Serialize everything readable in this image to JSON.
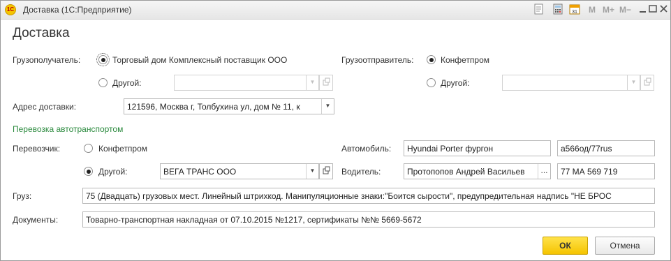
{
  "window": {
    "title": "Доставка  (1С:Предприятие)",
    "toolbar_icons": [
      "note-icon",
      "calculator-icon",
      "calendar-icon"
    ],
    "memory_buttons": [
      "M",
      "M+",
      "M−"
    ],
    "controls": [
      "minimize-icon",
      "maximize-icon",
      "close-icon"
    ]
  },
  "form": {
    "heading": "Доставка",
    "consignee": {
      "label": "Грузополучатель:",
      "option1": "Торговый дом Комплексный поставщик ООО",
      "option2": "Другой:",
      "other_value": ""
    },
    "shipper": {
      "label": "Грузоотправитель:",
      "option1": "Конфетпром",
      "option2": "Другой:",
      "other_value": ""
    },
    "address": {
      "label": "Адрес доставки:",
      "value": "121596, Москва г, Толбухина ул, дом № 11, к"
    },
    "transport_section": "Перевозка автотранспортом",
    "carrier": {
      "label": "Перевозчик:",
      "option1": "Конфетпром",
      "option2": "Другой:",
      "other_value": "ВЕГА ТРАНС ООО"
    },
    "vehicle": {
      "label": "Автомобиль:",
      "model": "Hyundai Porter фургон",
      "plate": "а566од/77rus"
    },
    "driver": {
      "label": "Водитель:",
      "name": "Протопопов Андрей Васильев",
      "select_label": "...",
      "license": "77 МА 569 719"
    },
    "cargo": {
      "label": "Груз:",
      "value": "75 (Двадцать) грузовых мест. Линейный штрихкод. Манипуляционные знаки:\"Боится сырости\", предупредительная надпись \"НЕ БРОС"
    },
    "documents": {
      "label": "Документы:",
      "value": "Товарно-транспортная накладная от 07.10.2015 №1217, сертификаты №№ 5669-5672"
    }
  },
  "buttons": {
    "ok": "ОК",
    "cancel": "Отмена"
  }
}
